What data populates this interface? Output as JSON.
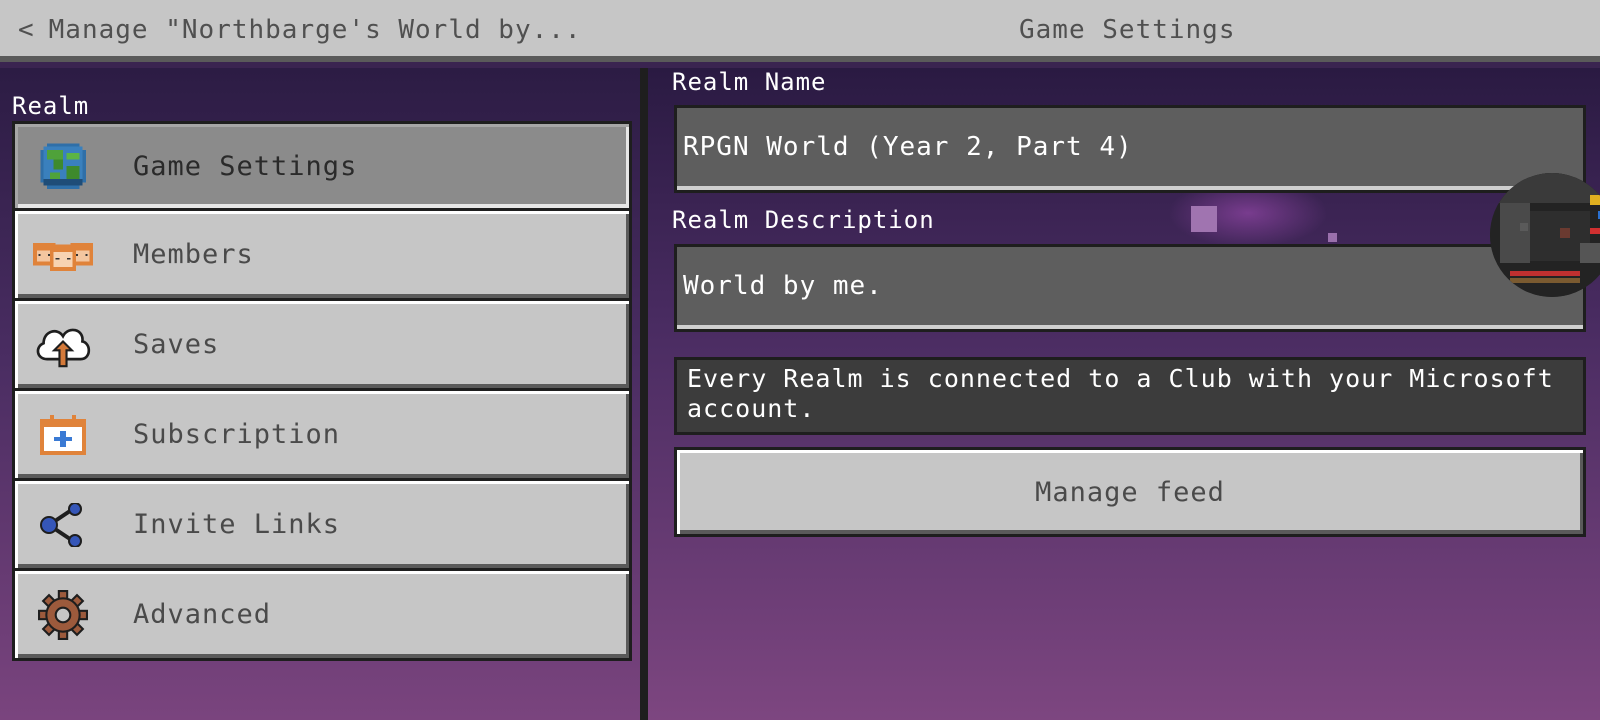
{
  "header": {
    "back_label": "Manage \"Northbarge's World by...",
    "title": "Game Settings"
  },
  "sidebar": {
    "section_label": "Realm",
    "items": [
      {
        "label": "Game Settings",
        "icon": "globe-icon",
        "active": true
      },
      {
        "label": "Members",
        "icon": "members-icon",
        "active": false
      },
      {
        "label": "Saves",
        "icon": "cloud-upload-icon",
        "active": false
      },
      {
        "label": "Subscription",
        "icon": "calendar-plus-icon",
        "active": false
      },
      {
        "label": "Invite Links",
        "icon": "share-icon",
        "active": false
      },
      {
        "label": "Advanced",
        "icon": "gear-icon",
        "active": false
      }
    ]
  },
  "form": {
    "realm_name_label": "Realm Name",
    "realm_name_value": "RPGN World (Year 2, Part 4)",
    "realm_description_label": "Realm Description",
    "realm_description_value": "World by me.",
    "info_text": "Every Realm is connected to a Club with your Microsoft account.",
    "manage_feed_label": "Manage feed"
  },
  "colors": {
    "button_face": "#c6c6c6",
    "button_active": "#8b8b8b",
    "field_bg": "#5e5e5e",
    "background_top": "#2a1a42",
    "background_bottom": "#7d4680"
  }
}
